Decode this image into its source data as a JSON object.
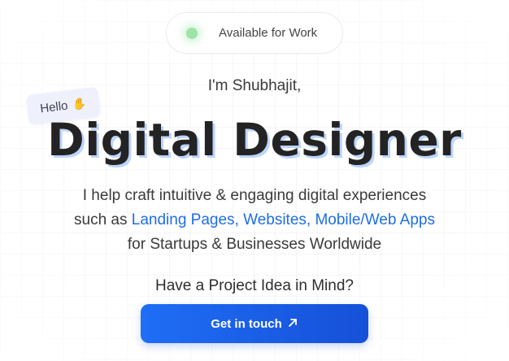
{
  "status": {
    "label": "Available for Work",
    "dot_color": "#9fe3a6"
  },
  "hero": {
    "greeting": "I'm Shubhajit,",
    "badge": {
      "label": "Hello",
      "icon": "wave-icon"
    },
    "title": "Digital Designer",
    "description": {
      "line1": "I help craft intuitive & engaging digital experiences",
      "line2_prefix": "such as ",
      "line2_highlight": "Landing Pages, Websites, Mobile/Web Apps",
      "line3": "for Startups & Businesses Worldwide"
    }
  },
  "cta": {
    "question": "Have a Project Idea in Mind?",
    "button_label": "Get in touch",
    "button_icon": "arrow-up-right-icon"
  },
  "colors": {
    "accent": "#1e6de6",
    "title_shadow": "#bcd4ff"
  }
}
